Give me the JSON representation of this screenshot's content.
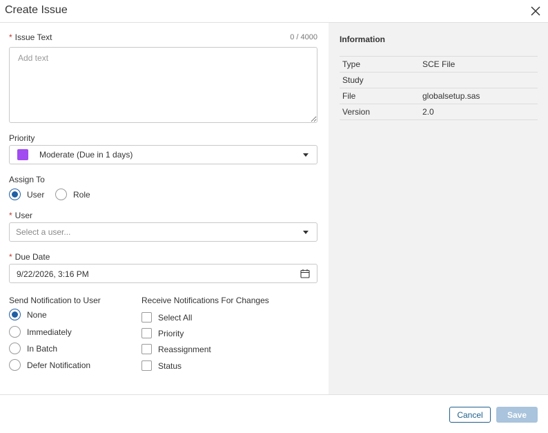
{
  "dialog": {
    "title": "Create Issue"
  },
  "form": {
    "issue_text": {
      "label": "Issue Text",
      "required_mark": "*",
      "counter": "0 / 4000",
      "placeholder": "Add text",
      "value": ""
    },
    "priority": {
      "label": "Priority",
      "value": "Moderate (Due in 1 days)",
      "swatch_color": "#a04cf0"
    },
    "assign_to": {
      "label": "Assign To",
      "options": [
        {
          "label": "User",
          "checked": true
        },
        {
          "label": "Role",
          "checked": false
        }
      ]
    },
    "user": {
      "label": "User",
      "required_mark": "*",
      "placeholder": "Select a user..."
    },
    "due_date": {
      "label": "Due Date",
      "required_mark": "*",
      "value": "9/22/2026, 3:16 PM",
      "icon": "calendar-icon"
    },
    "send_notification": {
      "label": "Send Notification to User",
      "options": [
        {
          "label": "None",
          "checked": true
        },
        {
          "label": "Immediately",
          "checked": false
        },
        {
          "label": "In Batch",
          "checked": false
        },
        {
          "label": "Defer Notification",
          "checked": false
        }
      ]
    },
    "receive_notifications": {
      "label": "Receive Notifications For Changes",
      "options": [
        {
          "label": "Select All",
          "checked": false
        },
        {
          "label": "Priority",
          "checked": false
        },
        {
          "label": "Reassignment",
          "checked": false
        },
        {
          "label": "Status",
          "checked": false
        }
      ]
    }
  },
  "information": {
    "title": "Information",
    "rows": [
      {
        "key": "Type",
        "value": "SCE File"
      },
      {
        "key": "Study",
        "value": ""
      },
      {
        "key": "File",
        "value": "globalsetup.sas"
      },
      {
        "key": "Version",
        "value": "2.0"
      }
    ]
  },
  "footer": {
    "cancel_label": "Cancel",
    "save_label": "Save"
  },
  "colors": {
    "accent": "#1f5fa3",
    "required": "#c0392b",
    "save_disabled": "#a9c4dc"
  }
}
